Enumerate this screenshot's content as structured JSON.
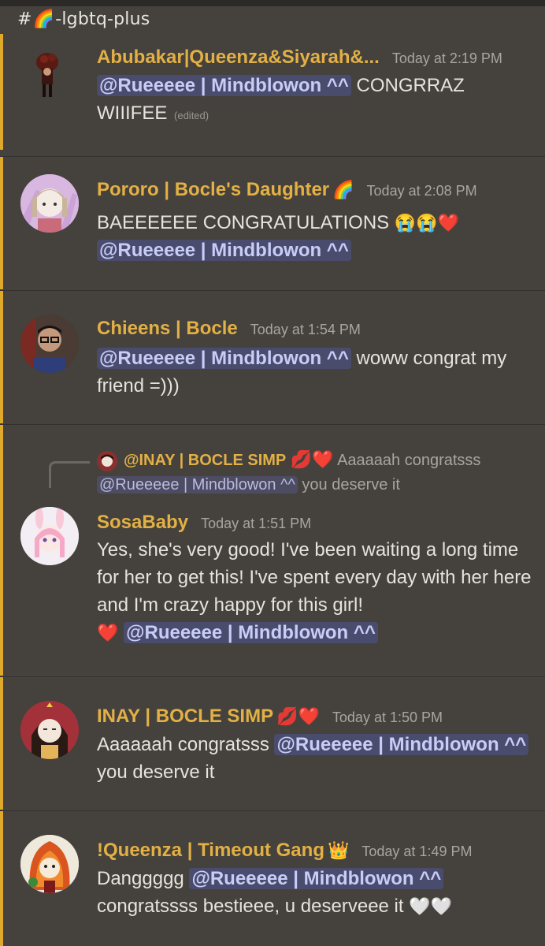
{
  "channel": {
    "hash": "#",
    "emoji": "🌈",
    "name": "-lgbtq-plus"
  },
  "messages": [
    {
      "username": "Abubakar|Queenza&Siyarah&...",
      "badge": "",
      "timestamp": "Today at 2:19 PM",
      "mention": "@Rueeeee | Mindblowon ^^",
      "text_after": " CONGRRAZ WIIIFEE",
      "edited": "(edited)"
    },
    {
      "username": "Pororo | Bocle's Daughter",
      "badge": "🌈",
      "timestamp": "Today at 2:08 PM",
      "text_before": "BAEEEEEE CONGRATULATIONS ",
      "emojis": "😭😭❤️",
      "mention": "@Rueeeee | Mindblowon ^^"
    },
    {
      "username": "Chieens | Bocle",
      "badge": "",
      "timestamp": "Today at 1:54 PM",
      "mention": "@Rueeeee | Mindblowon ^^",
      "text_after": " woww congrat my friend =)))"
    },
    {
      "reply": {
        "username": "@INAY | BOCLE SIMP",
        "badge": "💋❤️",
        "text": "Aaaaaah congratsss",
        "mention": "@Rueeeee | Mindblowon ^^",
        "text_after": " you deserve it"
      },
      "username": "SosaBaby",
      "badge": "",
      "timestamp": "Today at 1:51 PM",
      "text": "Yes, she's very good! I've been waiting a long time for her to get this! I've spent every day with her here and I'm crazy happy for this girl!",
      "emoji": "❤️",
      "mention": "@Rueeeee | Mindblowon ^^"
    },
    {
      "username": "INAY | BOCLE SIMP",
      "badge": "💋❤️",
      "timestamp": "Today at 1:50 PM",
      "text_before": "Aaaaaah congratsss ",
      "mention": "@Rueeeee | Mindblowon ^^",
      "text_after": " you deserve it"
    },
    {
      "username": "!Queenza | Timeout Gang",
      "badge": "👑",
      "timestamp": "Today at 1:49 PM",
      "text_before": "Danggggg ",
      "mention": "@Rueeeee | Mindblowon ^^",
      "text_after": " congratssss bestieee, u deserveee it ",
      "emojis": "🤍🤍"
    }
  ],
  "colors": {
    "background": "#45423d",
    "username": "#e3b045",
    "accent_bar": "#e1a92b",
    "mention_bg": "#4a4c6e",
    "mention_text": "#c8cdf8"
  }
}
